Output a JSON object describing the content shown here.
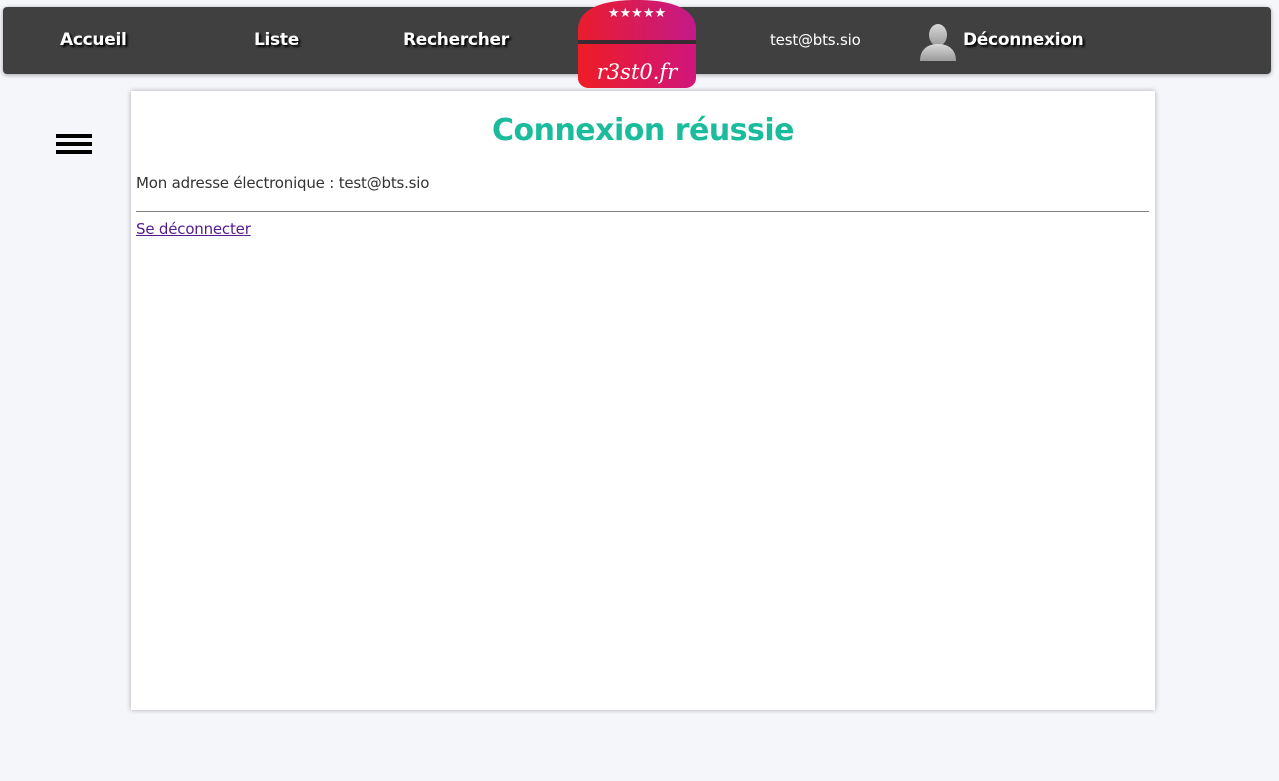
{
  "nav": {
    "accueil": "Accueil",
    "liste": "Liste",
    "rechercher": "Rechercher",
    "user_email": "test@bts.sio",
    "deconnexion": "Déconnexion",
    "avatar_icon": "user-silhouette-icon"
  },
  "logo": {
    "text": "r3st0.fr",
    "stars": "★★★★★",
    "colors": {
      "top": "#e8202a",
      "bottom": "#c2186f"
    }
  },
  "menu": {
    "icon": "hamburger-menu-icon"
  },
  "main": {
    "title": "Connexion réussie",
    "email_line": "Mon adresse électronique : test@bts.sio",
    "logout_link": "Se déconnecter"
  },
  "colors": {
    "navbar": "#404040",
    "title": "#1abc9c",
    "link_visited": "#551a8b",
    "background": "#f5f6fa"
  }
}
